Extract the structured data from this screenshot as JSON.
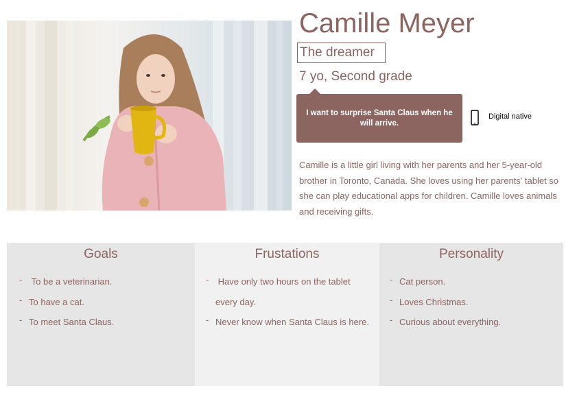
{
  "persona": {
    "name": "Camille Meyer",
    "tagline": "The dreamer",
    "age_grade": "7 yo, Second grade",
    "quote": "I want to surprise Santa Claus when he will arrive.",
    "device_label": "Digital native",
    "bio": "Camille is a little girl living with her parents and her 5-year-old brother in Toronto, Canada. She loves using her parents' tablet so she can play educational apps for children. Camille loves animals and receiving gifts."
  },
  "goals": {
    "title": "Goals",
    "items": [
      "To be a veterinarian.",
      "To have a cat.",
      "To meet Santa Claus."
    ]
  },
  "frustrations": {
    "title": "Frustations",
    "items": [
      "Have only two hours on the tablet every day.",
      "Never know when Santa Claus is here."
    ]
  },
  "personality": {
    "title": "Personality",
    "items": [
      "Cat person.",
      "Loves Christmas.",
      "Curious about everything."
    ]
  },
  "colors": {
    "accent": "#8c6460",
    "panel_gray": "#e6e6e6",
    "panel_light": "#f1f1f1"
  },
  "icons": {
    "device": "smartphone-icon"
  }
}
